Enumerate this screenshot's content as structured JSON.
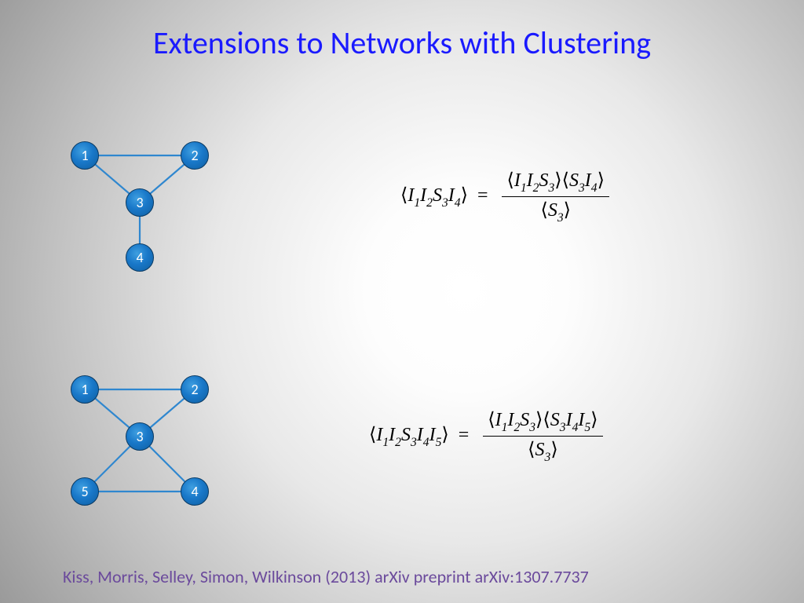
{
  "title": "Extensions to Networks with Clustering",
  "graph1": {
    "nodes": {
      "n1": "1",
      "n2": "2",
      "n3": "3",
      "n4": "4"
    }
  },
  "graph2": {
    "nodes": {
      "n1": "1",
      "n2": "2",
      "n3": "3",
      "n4": "4",
      "n5": "5"
    }
  },
  "eq1": {
    "lhs": {
      "I1": "I",
      "s1": "1",
      "I2": "I",
      "s2": "2",
      "S3": "S",
      "s3": "3",
      "I4": "I",
      "s4": "4"
    },
    "rhs_num_a": {
      "I1": "I",
      "s1": "1",
      "I2": "I",
      "s2": "2",
      "S3": "S",
      "s3": "3"
    },
    "rhs_num_b": {
      "S3": "S",
      "s3": "3",
      "I4": "I",
      "s4": "4"
    },
    "rhs_den": {
      "S3": "S",
      "s3": "3"
    }
  },
  "eq2": {
    "lhs": {
      "I1": "I",
      "s1": "1",
      "I2": "I",
      "s2": "2",
      "S3": "S",
      "s3": "3",
      "I4": "I",
      "s4": "4",
      "I5": "I",
      "s5": "5"
    },
    "rhs_num_a": {
      "I1": "I",
      "s1": "1",
      "I2": "I",
      "s2": "2",
      "S3": "S",
      "s3": "3"
    },
    "rhs_num_b": {
      "S3": "S",
      "s3": "3",
      "I4": "I",
      "s4": "4",
      "I5": "I",
      "s5": "5"
    },
    "rhs_den": {
      "S3": "S",
      "s3": "3"
    }
  },
  "citation": "Kiss, Morris, Selley, Simon, Wilkinson (2013) arXiv preprint arXiv:1307.7737"
}
